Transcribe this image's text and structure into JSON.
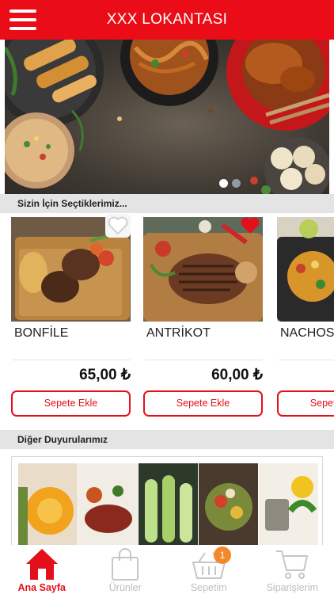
{
  "header": {
    "title": "XXX LOKANTASI",
    "menu_icon": "hamburger-menu-icon"
  },
  "banner": {
    "slide_count": 2,
    "active_slide": 1
  },
  "featured": {
    "title": "Sizin İçin Seçtiklerimiz...",
    "products": [
      {
        "name": "BONFİLE",
        "price": "65,00 ₺",
        "button": "Sepete Ekle",
        "favorite": false
      },
      {
        "name": "ANTRİKOT",
        "price": "60,00 ₺",
        "button": "Sepete Ekle",
        "favorite": true
      },
      {
        "name": "NACHOS",
        "price": "",
        "button": "Sepete Ekle",
        "favorite": false
      }
    ]
  },
  "announcements": {
    "title": "Diğer Duyurularımız"
  },
  "bottom_nav": {
    "items": [
      {
        "label": "Ana Sayfa",
        "icon": "home-icon",
        "active": true
      },
      {
        "label": "Ürünler",
        "icon": "shopping-bag-icon",
        "active": false
      },
      {
        "label": "Sepetim",
        "icon": "basket-icon",
        "active": false,
        "badge": "1"
      },
      {
        "label": "Siparişlerim",
        "icon": "cart-icon",
        "active": false
      }
    ]
  },
  "colors": {
    "brand": "#ea0d18",
    "badge": "#f08a2b",
    "section_bg": "#e4e4e4"
  }
}
